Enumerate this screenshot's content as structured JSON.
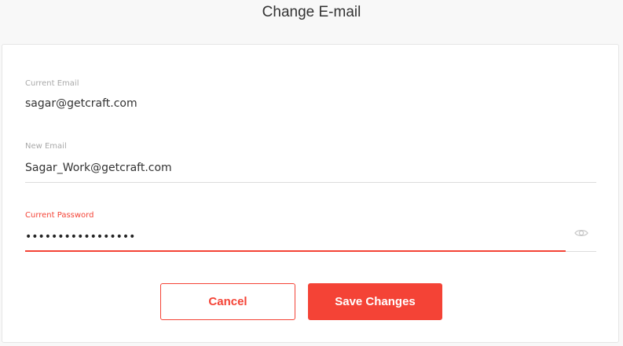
{
  "page": {
    "title": "Change E-mail"
  },
  "form": {
    "current_email": {
      "label": "Current Email",
      "value": "sagar@getcraft.com"
    },
    "new_email": {
      "label": "New Email",
      "value": "Sagar_Work@getcraft.com"
    },
    "current_password": {
      "label": "Current Password",
      "value": "•••••••••••••••••",
      "state": "error",
      "toggle_icon": "eye-icon"
    }
  },
  "actions": {
    "cancel_label": "Cancel",
    "save_label": "Save Changes"
  },
  "colors": {
    "accent": "#f44336",
    "text": "#333333",
    "muted_label": "#a9a9a9",
    "divider": "#dcdcdc",
    "background": "#f8f8f8"
  }
}
